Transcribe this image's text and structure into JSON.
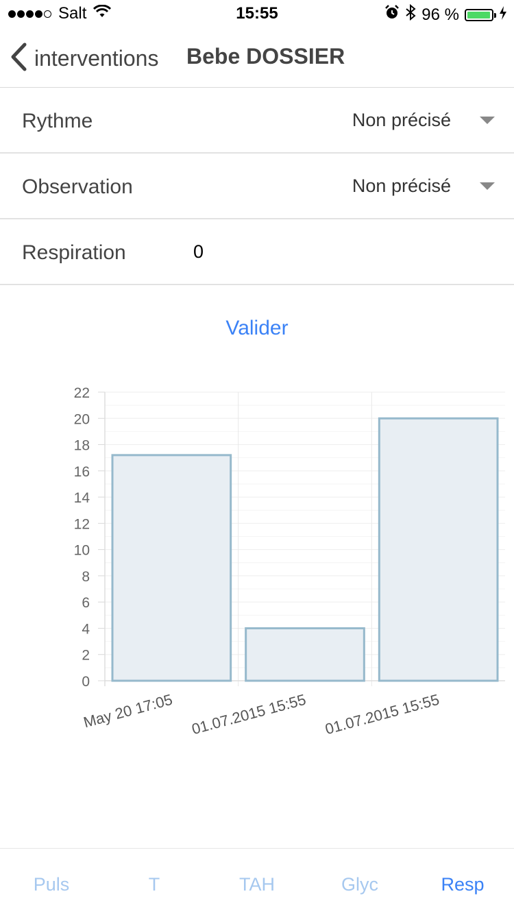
{
  "status_bar": {
    "carrier": "Salt",
    "time": "15:55",
    "battery_percent": "96 %",
    "battery_level": 0.96,
    "battery_color": "#4cd964"
  },
  "nav": {
    "back_label": "interventions",
    "title": "Bebe DOSSIER",
    "back_icon": "chevron-left-icon"
  },
  "form": {
    "rythme": {
      "label": "Rythme",
      "value": "Non précisé"
    },
    "observation": {
      "label": "Observation",
      "value": "Non précisé"
    },
    "respiration": {
      "label": "Respiration",
      "value": "0"
    }
  },
  "validate_label": "Valider",
  "chart_data": {
    "type": "bar",
    "categories": [
      "May 20 17:05",
      "01.07.2015 15:55",
      "01.07.2015 15:55"
    ],
    "values": [
      17.2,
      4,
      20
    ],
    "y_ticks": [
      "0",
      "2",
      "4",
      "6",
      "8",
      "10",
      "12",
      "14",
      "16",
      "18",
      "20",
      "22"
    ],
    "ylim": [
      0,
      22
    ],
    "grid": true,
    "bar_fill": "#e8eef3",
    "bar_stroke": "#96b9cc"
  },
  "tabs": [
    {
      "label": "Puls",
      "active": false
    },
    {
      "label": "T",
      "active": false
    },
    {
      "label": "TAH",
      "active": false
    },
    {
      "label": "Glyc",
      "active": false
    },
    {
      "label": "Resp",
      "active": true
    }
  ],
  "colors": {
    "accent": "#3b82f6",
    "inactive_tab": "#a6c8ef"
  }
}
